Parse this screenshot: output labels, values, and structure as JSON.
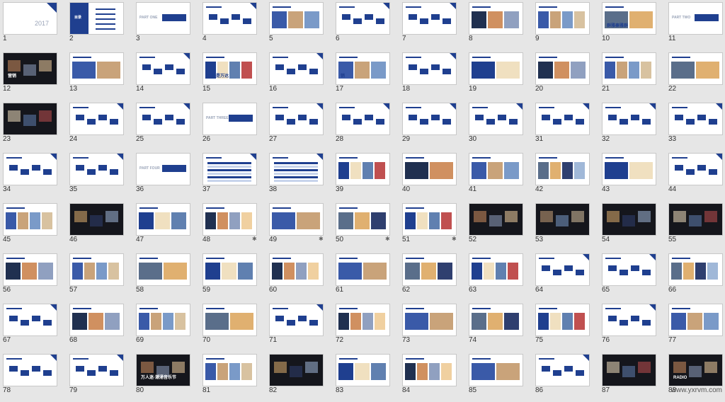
{
  "colors": {
    "background": "#e6e6e6",
    "accent": "#1f3f8f",
    "slide": "#ffffff",
    "dark": "#15161c"
  },
  "view": "slide-sorter",
  "slides": [
    {
      "n": "1",
      "t": "blue",
      "text": "2017"
    },
    {
      "n": "2",
      "t": "toc",
      "text": "目录"
    },
    {
      "n": "3",
      "t": "part",
      "text": "PART ONE"
    },
    {
      "n": "4",
      "t": "diagram"
    },
    {
      "n": "5",
      "t": "photo"
    },
    {
      "n": "6",
      "t": "diagram"
    },
    {
      "n": "7",
      "t": "diagram"
    },
    {
      "n": "8",
      "t": "photo"
    },
    {
      "n": "9",
      "t": "photo"
    },
    {
      "n": "10",
      "t": "photo",
      "text": "群雅秦雅群"
    },
    {
      "n": "11",
      "t": "part",
      "text": "PART TWO"
    },
    {
      "n": "12",
      "t": "dark",
      "text": "营销"
    },
    {
      "n": "13",
      "t": "photo"
    },
    {
      "n": "14",
      "t": "diagram"
    },
    {
      "n": "15",
      "t": "photo",
      "text": "欢乐是万达"
    },
    {
      "n": "16",
      "t": "diagram"
    },
    {
      "n": "17",
      "t": "photo",
      "text": "销"
    },
    {
      "n": "18",
      "t": "diagram"
    },
    {
      "n": "19",
      "t": "photo"
    },
    {
      "n": "20",
      "t": "photo"
    },
    {
      "n": "21",
      "t": "photo"
    },
    {
      "n": "22",
      "t": "photo"
    },
    {
      "n": "23",
      "t": "dark"
    },
    {
      "n": "24",
      "t": "diagram"
    },
    {
      "n": "25",
      "t": "diagram"
    },
    {
      "n": "26",
      "t": "part",
      "text": "PART THREE"
    },
    {
      "n": "27",
      "t": "diagram"
    },
    {
      "n": "28",
      "t": "diagram"
    },
    {
      "n": "29",
      "t": "diagram"
    },
    {
      "n": "30",
      "t": "diagram"
    },
    {
      "n": "31",
      "t": "diagram"
    },
    {
      "n": "32",
      "t": "diagram"
    },
    {
      "n": "33",
      "t": "diagram"
    },
    {
      "n": "34",
      "t": "diagram"
    },
    {
      "n": "35",
      "t": "diagram"
    },
    {
      "n": "36",
      "t": "part",
      "text": "PART FOUR"
    },
    {
      "n": "37",
      "t": "table"
    },
    {
      "n": "38",
      "t": "table"
    },
    {
      "n": "39",
      "t": "photo"
    },
    {
      "n": "40",
      "t": "photo"
    },
    {
      "n": "41",
      "t": "photo"
    },
    {
      "n": "42",
      "t": "photo"
    },
    {
      "n": "43",
      "t": "photo"
    },
    {
      "n": "44",
      "t": "diagram"
    },
    {
      "n": "45",
      "t": "photo"
    },
    {
      "n": "46",
      "t": "dark"
    },
    {
      "n": "47",
      "t": "photo"
    },
    {
      "n": "48",
      "t": "photo",
      "star": true
    },
    {
      "n": "49",
      "t": "photo",
      "star": true
    },
    {
      "n": "50",
      "t": "photo",
      "star": true
    },
    {
      "n": "51",
      "t": "photo",
      "star": true
    },
    {
      "n": "52",
      "t": "dark"
    },
    {
      "n": "53",
      "t": "dark"
    },
    {
      "n": "54",
      "t": "dark"
    },
    {
      "n": "55",
      "t": "dark"
    },
    {
      "n": "56",
      "t": "photo"
    },
    {
      "n": "57",
      "t": "photo"
    },
    {
      "n": "58",
      "t": "photo"
    },
    {
      "n": "59",
      "t": "photo"
    },
    {
      "n": "60",
      "t": "photo"
    },
    {
      "n": "61",
      "t": "photo"
    },
    {
      "n": "62",
      "t": "photo"
    },
    {
      "n": "63",
      "t": "photo"
    },
    {
      "n": "64",
      "t": "diagram"
    },
    {
      "n": "65",
      "t": "diagram"
    },
    {
      "n": "66",
      "t": "photo"
    },
    {
      "n": "67",
      "t": "diagram"
    },
    {
      "n": "68",
      "t": "photo"
    },
    {
      "n": "69",
      "t": "photo"
    },
    {
      "n": "70",
      "t": "photo"
    },
    {
      "n": "71",
      "t": "diagram"
    },
    {
      "n": "72",
      "t": "photo"
    },
    {
      "n": "73",
      "t": "photo"
    },
    {
      "n": "74",
      "t": "photo"
    },
    {
      "n": "75",
      "t": "photo"
    },
    {
      "n": "76",
      "t": "diagram"
    },
    {
      "n": "77",
      "t": "photo"
    },
    {
      "n": "78",
      "t": "diagram"
    },
    {
      "n": "79",
      "t": "diagram"
    },
    {
      "n": "80",
      "t": "dark",
      "text": "万人迷·潮涌音乐节"
    },
    {
      "n": "81",
      "t": "photo"
    },
    {
      "n": "82",
      "t": "dark"
    },
    {
      "n": "83",
      "t": "photo"
    },
    {
      "n": "84",
      "t": "photo"
    },
    {
      "n": "85",
      "t": "photo"
    },
    {
      "n": "86",
      "t": "diagram"
    },
    {
      "n": "87",
      "t": "dark"
    },
    {
      "n": "88",
      "t": "dark",
      "text": "RADIO"
    }
  ],
  "watermark": "www.yxrvm.com"
}
